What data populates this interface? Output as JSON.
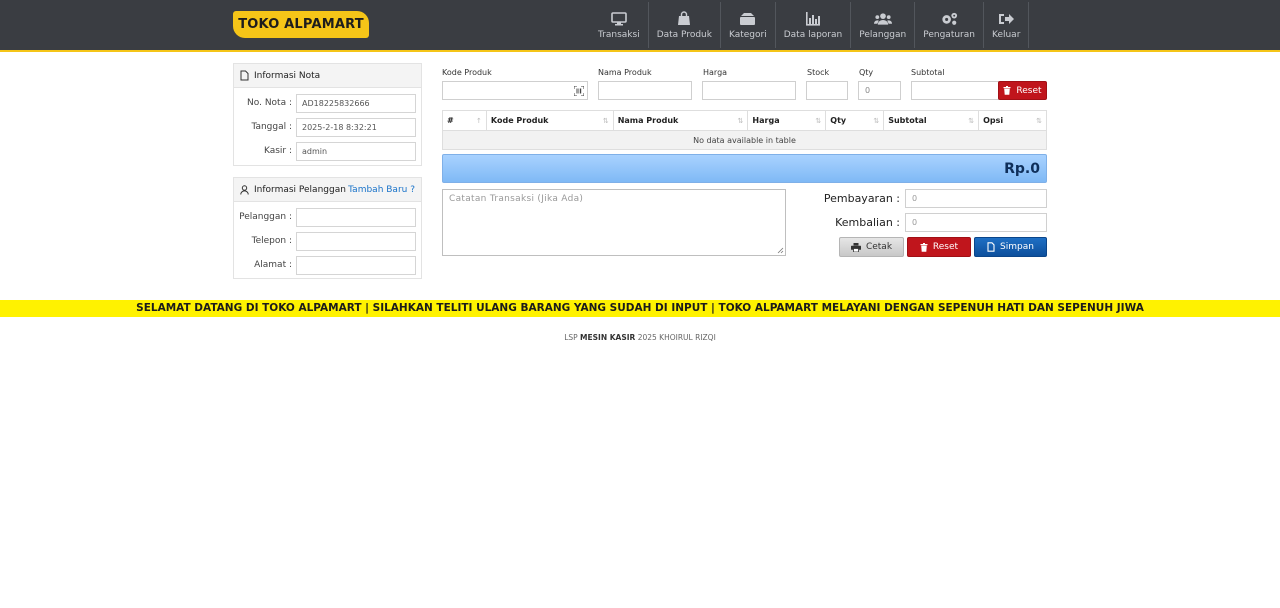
{
  "brand": "TOKO ALPAMART",
  "nav": {
    "transaksi": "Transaksi",
    "data_produk": "Data Produk",
    "kategori": "Kategori",
    "data_laporan": "Data laporan",
    "pelanggan": "Pelanggan",
    "pengaturan": "Pengaturan",
    "keluar": "Keluar"
  },
  "nota": {
    "title": "Informasi Nota",
    "no_nota_label": "No. Nota :",
    "no_nota_value": "AD18225832666",
    "tanggal_label": "Tanggal :",
    "tanggal_value": "2025-2-18 8:32:21",
    "kasir_label": "Kasir :",
    "kasir_value": "admin"
  },
  "pelanggan": {
    "title": "Informasi Pelanggan",
    "tambah": "Tambah Baru ?",
    "pelanggan_label": "Pelanggan :",
    "pelanggan_value": "",
    "telepon_label": "Telepon :",
    "telepon_value": "",
    "alamat_label": "Alamat :",
    "alamat_value": ""
  },
  "entry": {
    "kode_label": "Kode Produk",
    "kode_value": "",
    "nama_label": "Nama Produk",
    "nama_value": "",
    "harga_label": "Harga",
    "harga_value": "",
    "stock_label": "Stock",
    "stock_value": "",
    "qty_label": "Qty",
    "qty_value": "0",
    "subtotal_label": "Subtotal",
    "subtotal_value": "",
    "reset_label": "Reset"
  },
  "table": {
    "headers": [
      "#",
      "Kode Produk",
      "Nama Produk",
      "Harga",
      "Qty",
      "Subtotal",
      "Opsi"
    ],
    "empty": "No data available in table"
  },
  "total": "Rp.0",
  "catatan_placeholder": "Catatan Transaksi (Jika Ada)",
  "payment": {
    "pembayaran_label": "Pembayaran :",
    "pembayaran_value": "0",
    "kembalian_label": "Kembalian :",
    "kembalian_value": "0"
  },
  "actions": {
    "cetak": "Cetak",
    "reset": "Reset",
    "simpan": "Simpan"
  },
  "marquee": "SELAMAT DATANG DI TOKO ALPAMART | SILAHKAN TELITI ULANG BARANG YANG SUDAH DI INPUT | TOKO ALPAMART MELAYANI DENGAN SEPENUH HATI DAN SEPENUH JIWA",
  "footer": {
    "prefix": "LSP",
    "bold": "MESIN KASIR",
    "suffix": "2025 KHOIRUL RIZQI"
  }
}
